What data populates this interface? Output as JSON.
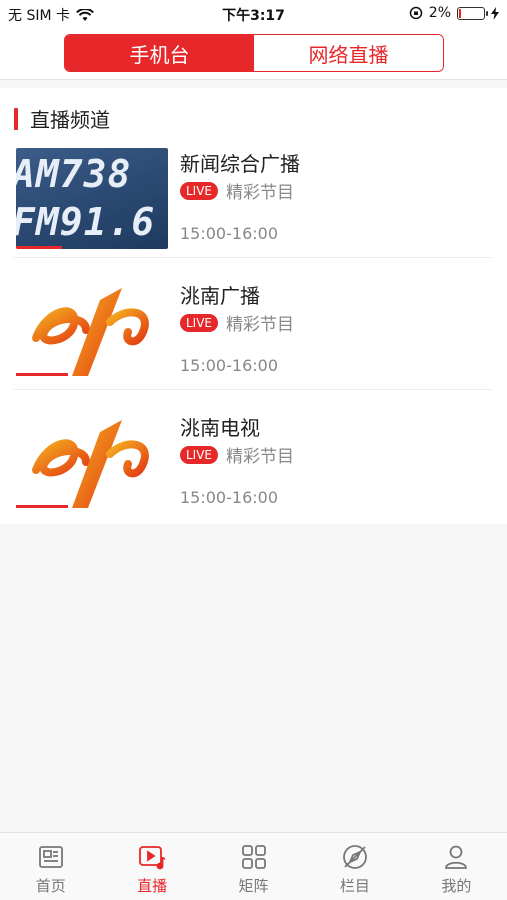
{
  "status": {
    "carrier": "无 SIM 卡",
    "time": "下午3:17",
    "battery": "2%",
    "battery_level": 0.02
  },
  "header": {
    "tabs": [
      {
        "label": "手机台",
        "active": true
      },
      {
        "label": "网络直播",
        "active": false
      }
    ]
  },
  "section": {
    "title": "直播频道"
  },
  "channels": [
    {
      "name": "新闻综合广播",
      "badge": "LIVE",
      "program": "精彩节目",
      "time": "15:00-16:00",
      "thumb_lines": [
        "AM738",
        "FM91.6"
      ]
    },
    {
      "name": "洮南广播",
      "badge": "LIVE",
      "program": "精彩节目",
      "time": "15:00-16:00"
    },
    {
      "name": "洮南电视",
      "badge": "LIVE",
      "program": "精彩节目",
      "time": "15:00-16:00"
    }
  ],
  "tabbar": [
    {
      "label": "首页",
      "icon": "newspaper-icon",
      "active": false
    },
    {
      "label": "直播",
      "icon": "live-video-icon",
      "active": true
    },
    {
      "label": "矩阵",
      "icon": "grid-icon",
      "active": false
    },
    {
      "label": "栏目",
      "icon": "compass-icon",
      "active": false
    },
    {
      "label": "我的",
      "icon": "user-icon",
      "active": false
    }
  ],
  "colors": {
    "accent": "#e6282a",
    "inactive_tab": "#777777"
  }
}
